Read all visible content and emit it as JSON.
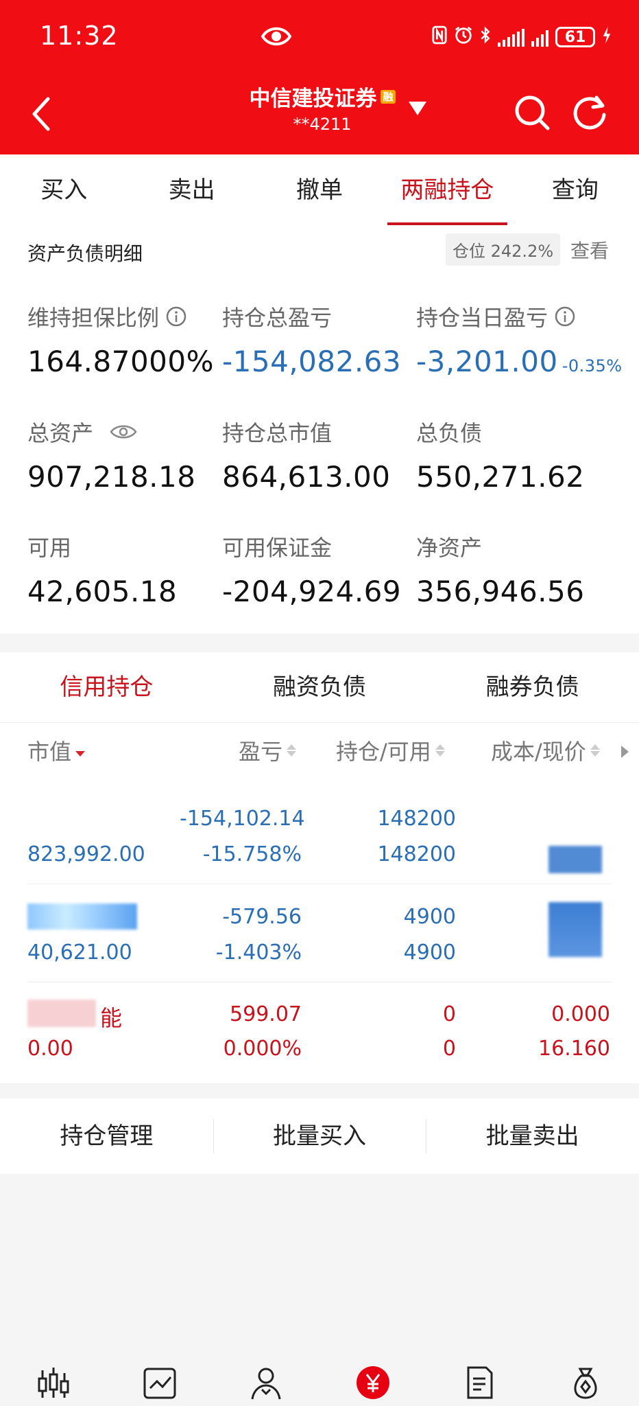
{
  "status_bar": {
    "time": "11:32",
    "battery": "61",
    "icons": [
      "eye-icon",
      "nfc-icon",
      "alarm-icon",
      "bluetooth-icon",
      "signal-icon",
      "signal-icon",
      "battery-icon",
      "charging-icon"
    ]
  },
  "header": {
    "broker_name": "中信建投证券",
    "badge": "融",
    "account": "**4211"
  },
  "tabs": [
    {
      "label": "买入"
    },
    {
      "label": "卖出"
    },
    {
      "label": "撤单"
    },
    {
      "label": "两融持仓",
      "active": true
    },
    {
      "label": "查询"
    }
  ],
  "asset": {
    "title": "资产负债明细",
    "position_label": "仓位 242.2%",
    "view_label": "查看",
    "maintenance_ratio": {
      "label": "维持担保比例",
      "value": "164.87000%"
    },
    "total_pnl": {
      "label": "持仓总盈亏",
      "value": "-154,082.63"
    },
    "daily_pnl": {
      "label": "持仓当日盈亏",
      "value": "-3,201.00",
      "pct": "-0.35%"
    },
    "total_assets": {
      "label": "总资产",
      "value": "907,218.18"
    },
    "market_value": {
      "label": "持仓总市值",
      "value": "864,613.00"
    },
    "total_liability": {
      "label": "总负债",
      "value": "550,271.62"
    },
    "available": {
      "label": "可用",
      "value": "42,605.18"
    },
    "available_margin": {
      "label": "可用保证金",
      "value": "-204,924.69"
    },
    "net_assets": {
      "label": "净资产",
      "value": "356,946.56"
    }
  },
  "holdings": {
    "tabs": [
      {
        "label": "信用持仓",
        "active": true
      },
      {
        "label": "融资负债"
      },
      {
        "label": "融券负债"
      }
    ],
    "columns": [
      "市值",
      "盈亏",
      "持仓/可用",
      "成本/现价"
    ],
    "rows": [
      {
        "market_value": "823,992.00",
        "pnl": "-154,102.14",
        "pnl_pct": "-15.758%",
        "position": "148200",
        "available": "148200",
        "color": "blue"
      },
      {
        "market_value": "40,621.00",
        "pnl": "-579.56",
        "pnl_pct": "-1.403%",
        "position": "4900",
        "available": "4900",
        "color": "blue"
      },
      {
        "name_suffix": "能",
        "market_value": "0.00",
        "pnl": "599.07",
        "pnl_pct": "0.000%",
        "position": "0",
        "available": "0",
        "cost": "0.000",
        "price": "16.160",
        "color": "red"
      }
    ]
  },
  "actions": [
    {
      "label": "持仓管理"
    },
    {
      "label": "批量买入"
    },
    {
      "label": "批量卖出"
    }
  ],
  "bottom_nav": [
    "candlestick-icon",
    "trend-chart-icon",
    "user-icon",
    "yuan-trade-icon",
    "document-icon",
    "money-bag-icon"
  ],
  "colors": {
    "brand_red": "#f00d14",
    "loss_blue": "#2a6fb5",
    "profit_red": "#c8121c"
  }
}
